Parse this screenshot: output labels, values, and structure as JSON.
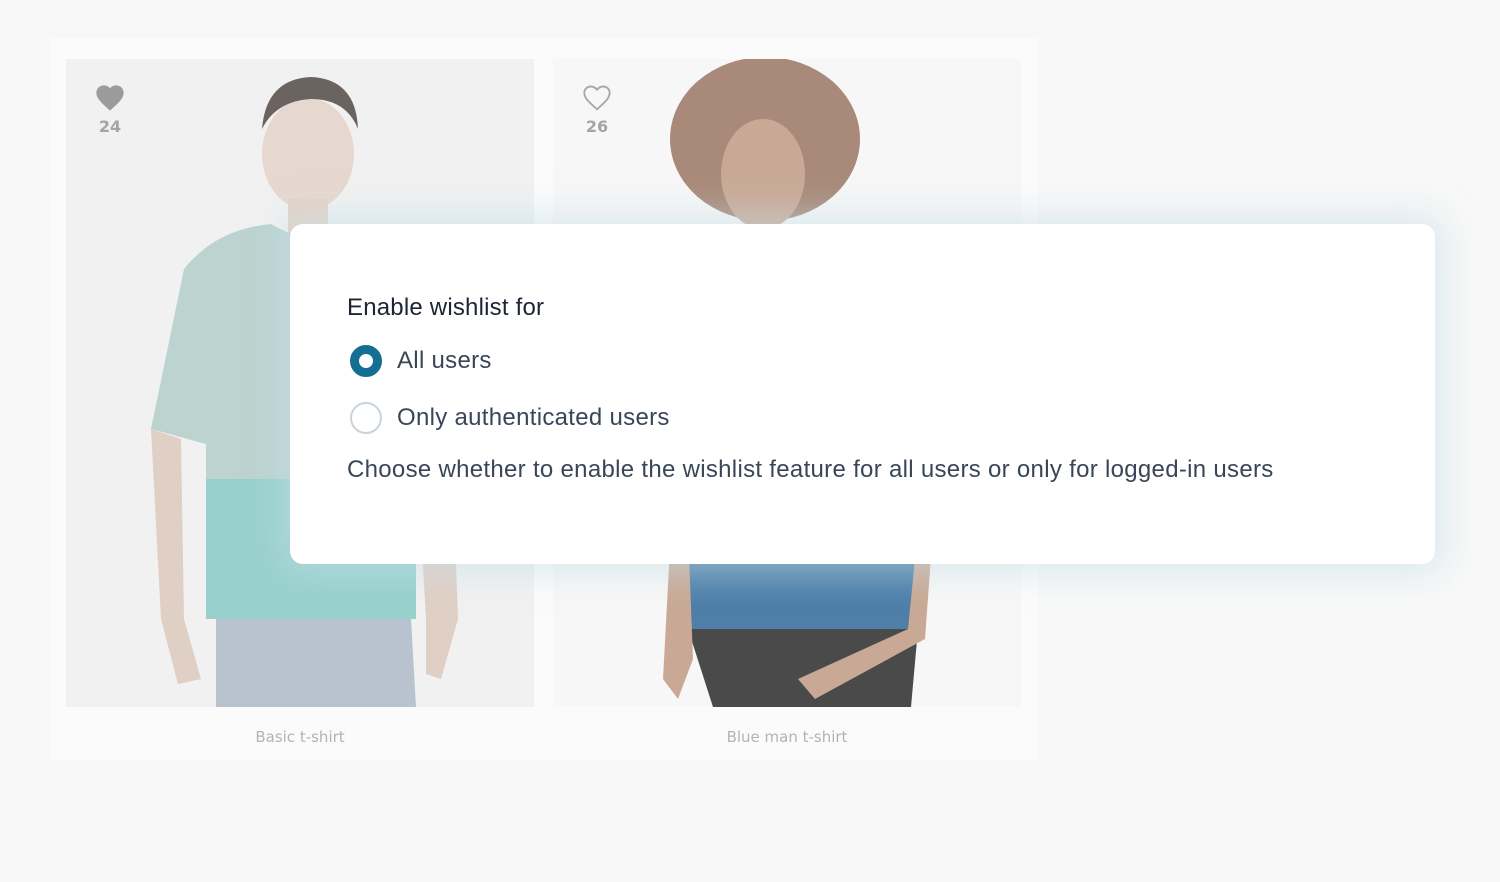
{
  "products": [
    {
      "name": "Basic t-shirt",
      "wishlist_count": "24",
      "wishlisted": true,
      "icon": "heart-filled-icon"
    },
    {
      "name": "Blue man t-shirt",
      "wishlist_count": "26",
      "wishlisted": false,
      "icon": "heart-outline-icon"
    }
  ],
  "settings": {
    "title": "Enable wishlist for",
    "options": [
      {
        "label": "All users",
        "selected": true
      },
      {
        "label": "Only authenticated users",
        "selected": false
      }
    ],
    "help_text": "Choose whether to enable the wishlist feature for all users or only for logged-in users"
  },
  "colors": {
    "accent": "#156f92",
    "text": "#3a4658",
    "heading": "#1c2533",
    "muted": "#a4a4a4"
  }
}
